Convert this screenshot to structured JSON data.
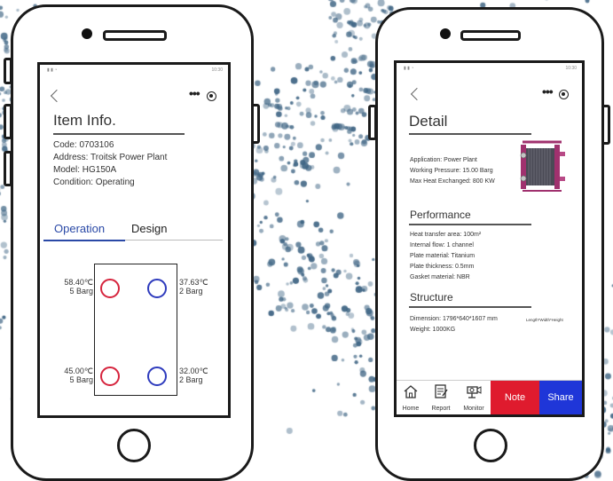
{
  "colors": {
    "hot_port": "#d6243d",
    "cold_port": "#2e3bbd",
    "tab_active": "#2a49a6",
    "note_btn": "#df1b2e",
    "share_btn": "#1f36d8",
    "dot_color": "#3f6584"
  },
  "status_bar": {
    "right_text": "10:30"
  },
  "item_info": {
    "title": "Item Info.",
    "code": "Code:  0703106",
    "address": "Address:  Troitsk Power Plant",
    "model": "Model:  HG150A",
    "condition": "Condition:  Operating",
    "tabs": [
      {
        "label": "Operation",
        "active": true
      },
      {
        "label": "Design",
        "active": false
      }
    ],
    "ports": {
      "top_left": {
        "temp": "58.40℃",
        "pressure": "5 Barg"
      },
      "top_right": {
        "temp": "37.63℃",
        "pressure": "2 Barg"
      },
      "bottom_left": {
        "temp": "45.00℃",
        "pressure": "5 Barg"
      },
      "bottom_right": {
        "temp": "32.00℃",
        "pressure": "2 Barg"
      }
    }
  },
  "detail": {
    "title": "Detail",
    "application": "Application: Power Plant",
    "working_pressure": "Working Pressure: 15.00 Barg",
    "max_heat": "Max Heat Exchanged: 800 KW",
    "performance_title": "Performance",
    "performance": [
      "Heat transfer area: 100m²",
      "Internal flow: 1 channel",
      "Plate material: Titanium",
      "Plate thickness: 0.5mm",
      "Gasket material: NBR"
    ],
    "structure_title": "Structure",
    "dimension": "Dimension: 1796*640*1607 mm",
    "dimension_note": "Length*Width*Height",
    "weight": "Weight: 1000KG"
  },
  "tabbar": {
    "home": "Home",
    "report": "Report",
    "monitor": "Monitor",
    "note": "Note",
    "share": "Share"
  },
  "icons": [
    "back-chevron-icon",
    "more-dots-icon",
    "target-icon",
    "home-icon",
    "report-icon",
    "monitor-icon",
    "heat-exchanger-image"
  ]
}
